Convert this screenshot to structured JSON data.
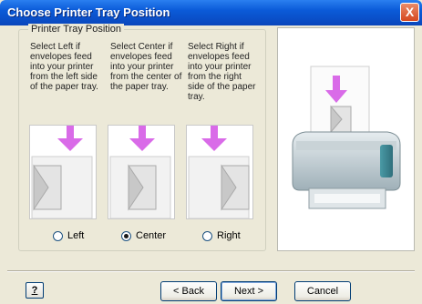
{
  "window": {
    "title": "Choose Printer Tray Position",
    "close_glyph": "X"
  },
  "group": {
    "legend": "Printer Tray Position"
  },
  "columns": [
    {
      "text": "Select Left if envelopes feed into your printer from the left side of the paper tray.",
      "radio_label": "Left",
      "selected": false,
      "icon": "envelope-left-feed-icon"
    },
    {
      "text": "Select Center if envelopes feed into your printer from the center of the paper tray.",
      "radio_label": "Center",
      "selected": true,
      "icon": "envelope-center-feed-icon"
    },
    {
      "text": "Select Right if envelopes feed into your printer from the right side of the paper tray.",
      "radio_label": "Right",
      "selected": false,
      "icon": "envelope-right-feed-icon"
    }
  ],
  "preview": {
    "icon": "printer-icon"
  },
  "buttons": {
    "help": "?",
    "back": "< Back",
    "next": "Next >",
    "cancel": "Cancel"
  },
  "colors": {
    "titlebar": "#0a4fc8",
    "arrow": "#d96be8"
  }
}
